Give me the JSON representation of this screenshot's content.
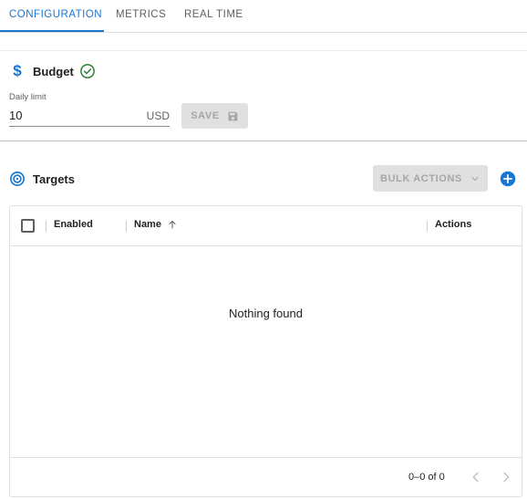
{
  "tabs": [
    {
      "label": "CONFIGURATION",
      "active": true
    },
    {
      "label": "METRICS",
      "active": false
    },
    {
      "label": "REAL TIME",
      "active": false
    }
  ],
  "budget": {
    "title": "Budget",
    "status_icon": "check-circle-icon",
    "field_label": "Daily limit",
    "value": "10",
    "currency": "USD",
    "save_label": "SAVE"
  },
  "targets": {
    "title": "Targets",
    "bulk_actions_label": "BULK ACTIONS",
    "columns": [
      "Enabled",
      "Name",
      "Actions"
    ],
    "empty_message": "Nothing found",
    "pagination": "0–0 of 0"
  },
  "colors": {
    "accent": "#1976d2",
    "success": "#2e7d32",
    "disabled_bg": "#e0e0e0",
    "disabled_text": "#a6a6a6"
  }
}
